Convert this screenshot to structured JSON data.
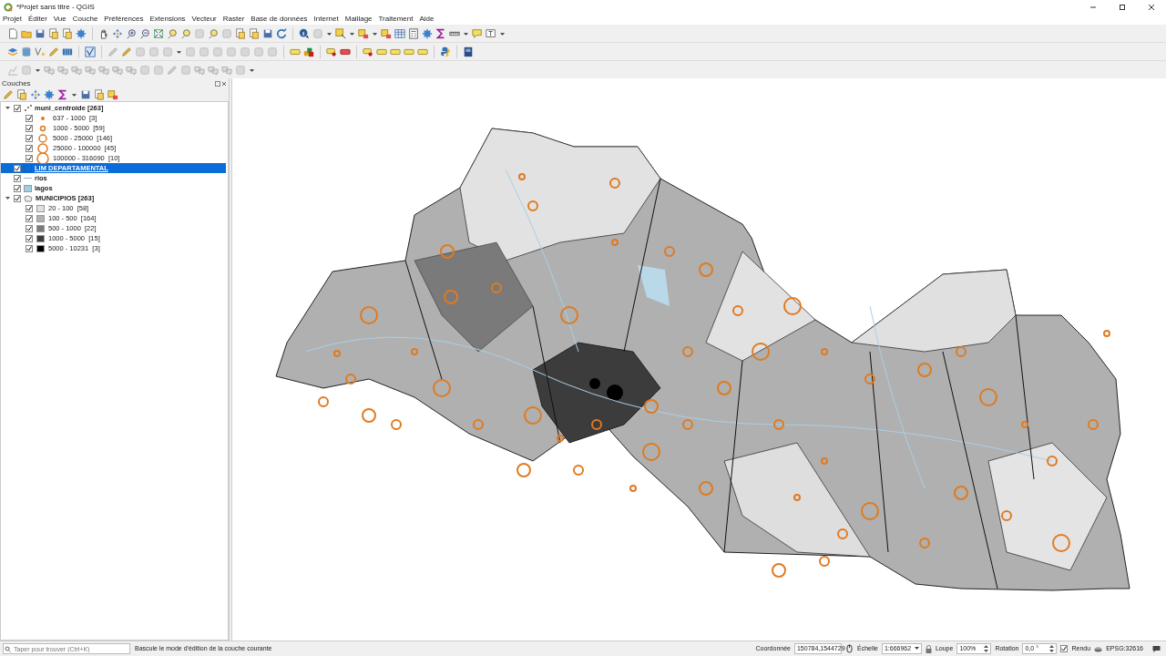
{
  "window": {
    "title": "*Projet sans titre - QGIS"
  },
  "menu": [
    "Projet",
    "Éditer",
    "Vue",
    "Couche",
    "Préférences",
    "Extensions",
    "Vecteur",
    "Raster",
    "Base de données",
    "Internet",
    "Maillage",
    "Traitement",
    "Aide"
  ],
  "layers_panel": {
    "title": "Couches",
    "layers": [
      {
        "name": "muni_centroide [263]",
        "kind": "points",
        "checked": true,
        "expanded": true,
        "selected": false,
        "children": [
          {
            "label": "637 - 1000  [3]",
            "kind": "circle",
            "checked": true
          },
          {
            "label": "1000 - 5000  [59]",
            "kind": "circle",
            "checked": true
          },
          {
            "label": "5000 - 25000  [146]",
            "kind": "circle",
            "checked": true
          },
          {
            "label": "25000 - 100000  [45]",
            "kind": "circle",
            "checked": true
          },
          {
            "label": "100000 - 316090  [10]",
            "kind": "circle",
            "checked": true
          }
        ]
      },
      {
        "name": "LIM DEPARTAMENTAL",
        "kind": "outline",
        "checked": true,
        "selected": true
      },
      {
        "name": "rios",
        "kind": "line",
        "checked": true,
        "selected": false
      },
      {
        "name": "lagos",
        "kind": "fill",
        "color": "#9fcfe0",
        "checked": true,
        "selected": false
      },
      {
        "name": "MUNICIPIOS [263]",
        "kind": "polygons",
        "checked": true,
        "expanded": true,
        "selected": false,
        "children": [
          {
            "label": "20 - 100  [58]",
            "kind": "fill",
            "color": "#e0e0e0",
            "checked": true
          },
          {
            "label": "100 - 500  [164]",
            "kind": "fill",
            "color": "#b0b0b0",
            "checked": true
          },
          {
            "label": "500 - 1000  [22]",
            "kind": "fill",
            "color": "#7a7a7a",
            "checked": true
          },
          {
            "label": "1000 - 5000  [15]",
            "kind": "fill",
            "color": "#3c3c3c",
            "checked": true
          },
          {
            "label": "5000 - 10231  [3]",
            "kind": "fill",
            "color": "#000000",
            "checked": true
          }
        ]
      }
    ]
  },
  "status_bar": {
    "search_placeholder": "Taper pour trouver (Ctrl+K)",
    "message": "Bascule le mode d'édition de la couche courante",
    "coordinate_label": "Coordonnée",
    "coordinate": "150784,1544729",
    "scale_label": "Échelle",
    "scale": "1:666962",
    "magnifier_label": "Loupe",
    "magnifier": "100%",
    "rotation_label": "Rotation",
    "rotation": "0,0 °",
    "render_label": "Rendu",
    "render_checked": true,
    "crs": "EPSG:32616"
  }
}
